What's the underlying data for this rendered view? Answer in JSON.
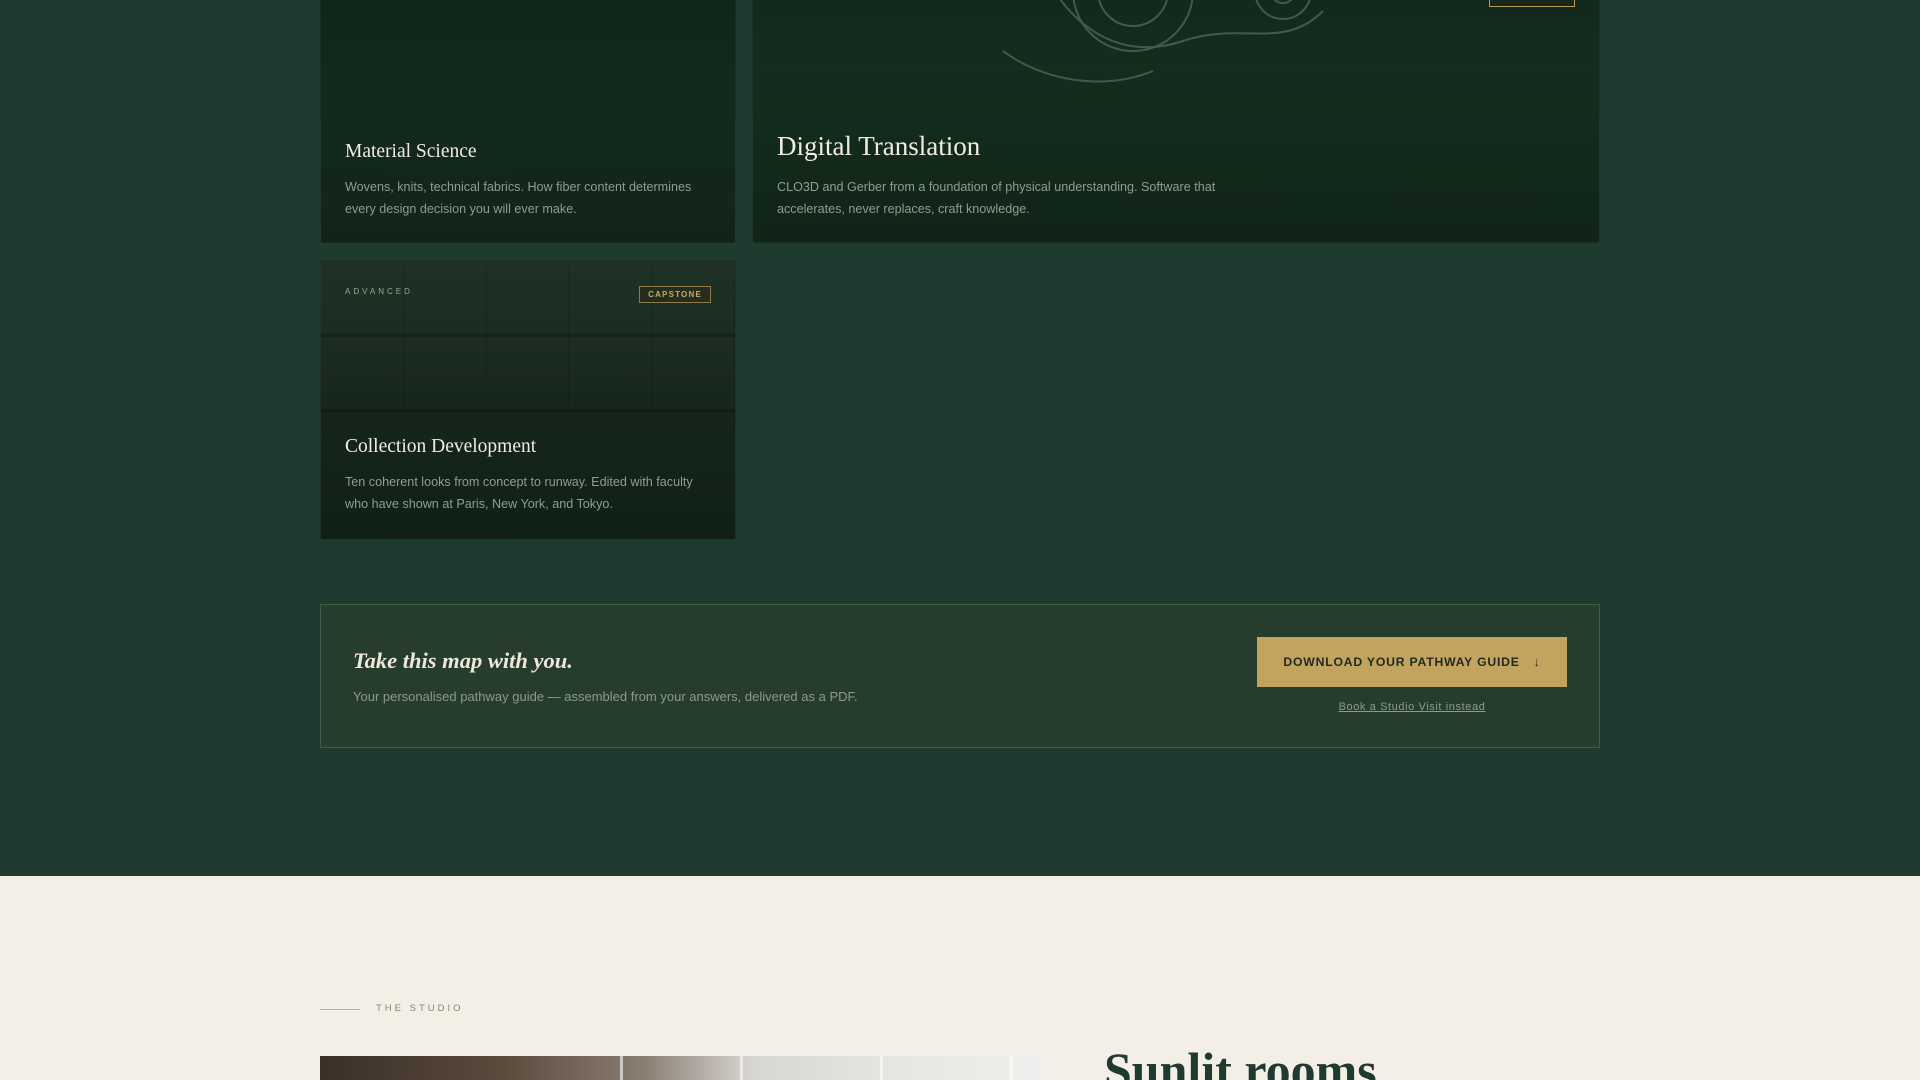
{
  "cards": {
    "material_science": {
      "title": "Material Science",
      "description": "Wovens, knits, technical fabrics. How fiber content determines every design decision you will ever make."
    },
    "digital_translation": {
      "title": "Digital Translation",
      "description": "CLO3D and Gerber from a foundation of physical understanding. Software that accelerates, never replaces, craft knowledge."
    },
    "collection_development": {
      "eyebrow": "ADVANCED",
      "badge": "CAPSTONE",
      "title": "Collection Development",
      "description": "Ten coherent looks from concept to runway. Edited with faculty who have shown at Paris, New York, and Tokyo."
    }
  },
  "cta": {
    "title": "Take this map with you.",
    "subtitle": "Your personalised pathway guide — assembled from your answers, delivered as a PDF.",
    "button_label": "DOWNLOAD YOUR PATHWAY GUIDE",
    "button_icon": "↓",
    "secondary_link": "Book a Studio Visit instead"
  },
  "studio": {
    "eyebrow": "THE STUDIO",
    "heading": "Sunlit rooms"
  },
  "colors": {
    "forest": "#1f3a2e",
    "gold": "#c2a45e",
    "cream": "#f4efe6"
  }
}
